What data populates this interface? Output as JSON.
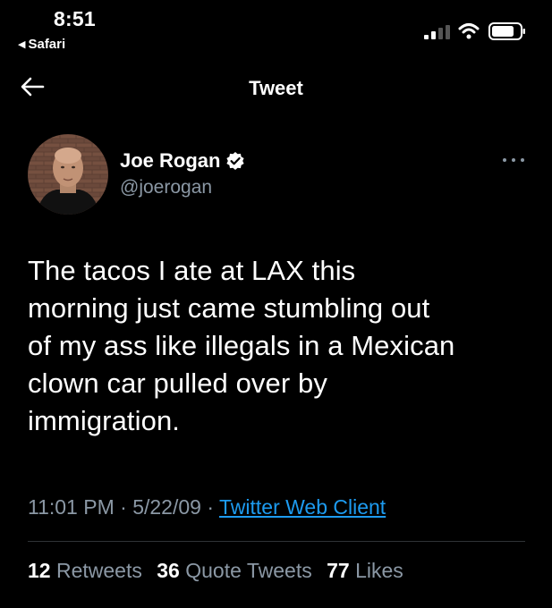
{
  "status_bar": {
    "time": "8:51",
    "back_app": "Safari",
    "icons": [
      "signal-bars-icon",
      "wifi-icon",
      "battery-icon"
    ]
  },
  "nav": {
    "back_icon": "back-arrow-icon",
    "title": "Tweet"
  },
  "tweet": {
    "author": {
      "name": "Joe Rogan",
      "handle": "@joerogan",
      "verified": true
    },
    "text": "The tacos I ate at LAX this\nmorning just came stumbling out\nof my ass like illegals in  a Mexican\nclown car pulled over by\nimmigration.",
    "time": "11:01 PM",
    "separator": "·",
    "date": "5/22/09",
    "client": "Twitter Web Client",
    "stats": {
      "retweets_count": "12",
      "retweets_label": "Retweets",
      "quotes_count": "36",
      "quotes_label": "Quote Tweets",
      "likes_count": "77",
      "likes_label": "Likes"
    }
  },
  "colors": {
    "background": "#000000",
    "link": "#1d9bf0",
    "secondary_text": "#8b98a5",
    "verified_badge": "#ffffff"
  }
}
